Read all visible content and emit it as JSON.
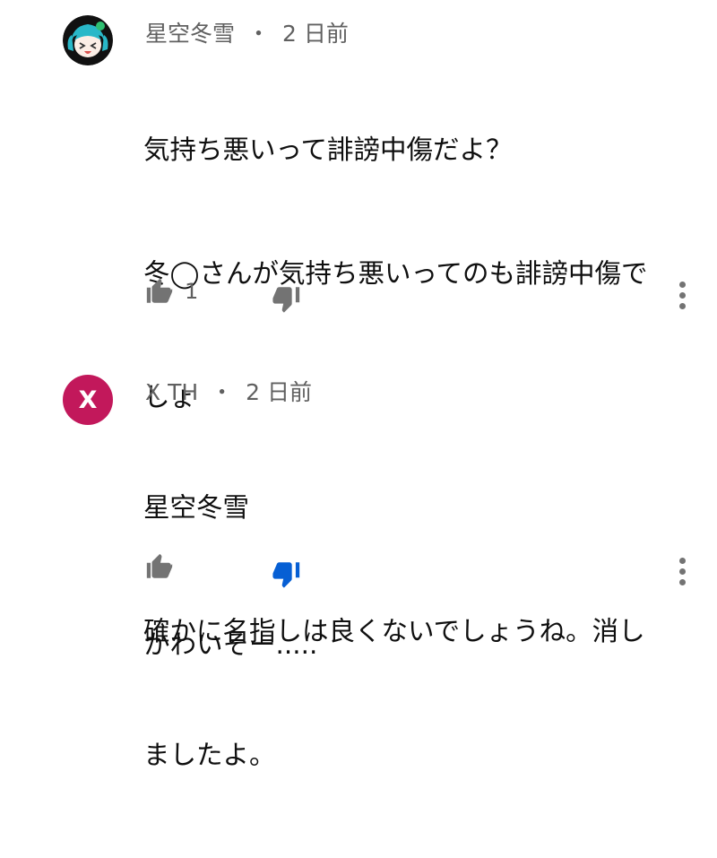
{
  "colors": {
    "meta_gray": "#606060",
    "icon_gray": "#737373",
    "dislike_active_blue": "#065fd4",
    "avatar2_bg": "#c2185b",
    "avatar1_bg": "#111111",
    "avatar1_hair": "#29b8c8"
  },
  "comments": [
    {
      "author": "星空冬雪",
      "separator": "・",
      "time": "2 日前",
      "avatar": "anime-character-avatar",
      "lines": [
        "気持ち悪いって誹謗中傷だよ？",
        "冬◯さんが気持ち悪いってのも誹謗中傷で",
        "しょ",
        "",
        "かわいそー....."
      ],
      "like_count": "1",
      "liked": false,
      "disliked": false,
      "icons": {
        "like": "thumbs-up-icon",
        "dislike": "thumbs-down-icon",
        "more": "more-vert-icon"
      }
    },
    {
      "author": "X TH",
      "separator": "・",
      "time": "2 日前",
      "avatar_initial": "X",
      "lines": [
        "星空冬雪",
        "確かに名指しは良くないでしょうね。消し",
        "ましたよ。"
      ],
      "like_count": "",
      "liked": false,
      "disliked": true,
      "icons": {
        "like": "thumbs-up-icon",
        "dislike": "thumbs-down-filled-icon",
        "more": "more-vert-icon"
      }
    }
  ]
}
